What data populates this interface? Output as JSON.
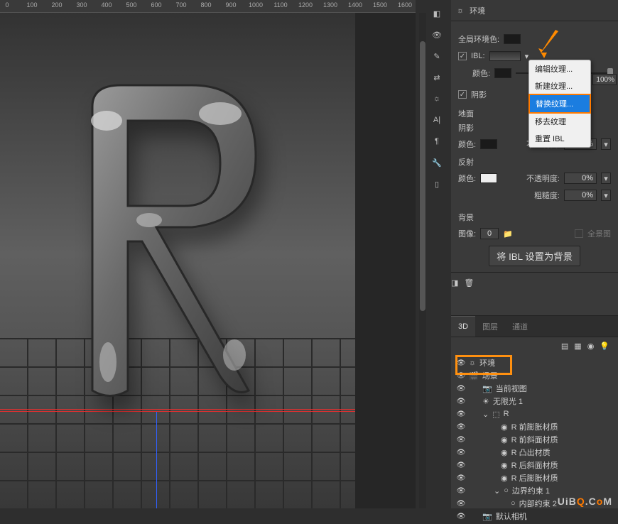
{
  "ruler": [
    "0",
    "100",
    "200",
    "300",
    "400",
    "500",
    "600",
    "700",
    "800",
    "900",
    "1000",
    "1100",
    "1200",
    "1300",
    "1400",
    "1500",
    "1600"
  ],
  "panel": {
    "title": "环境",
    "global_color_label": "全局环境色:",
    "ibl_label": "IBL:",
    "ibl_pct": "100%",
    "color_label": "颜色:",
    "shadow_label": "阴影",
    "ground_label": "地面",
    "ground_shadow_label": "阴影",
    "ground_color_label": "颜色:",
    "opacity_label": "不透明度:",
    "opacity_val": "60%",
    "reflection_label": "反射",
    "refl_color_label": "颜色:",
    "refl_opacity_label": "不透明度:",
    "refl_opacity_val": "0%",
    "roughness_label": "粗糙度:",
    "roughness_val": "0%",
    "background_label": "背景",
    "image_label": "图像:",
    "image_val": "0",
    "panorama_label": "全景图",
    "set_ibl_btn": "将 IBL 设置为背景"
  },
  "context_menu": {
    "edit": "编辑纹理...",
    "new": "新建纹理...",
    "replace": "替换纹理...",
    "remove": "移去纹理",
    "reset": "重置 IBL"
  },
  "tabs": {
    "d3": "3D",
    "layers": "图层",
    "channels": "通道"
  },
  "tree": {
    "env": "环境",
    "scene": "场景",
    "currentView": "当前视图",
    "light": "无限光 1",
    "r": "R",
    "mat_front_expand": "R 前膨胀材质",
    "mat_front_bevel": "R 前斜面材质",
    "mat_extrude": "R 凸出材质",
    "mat_back_bevel": "R 后斜面材质",
    "mat_back_expand": "R 后膨胀材质",
    "constraint1": "边界约束 1",
    "inner": "内部约束 2",
    "camera": "默认相机"
  },
  "watermark": {
    "t1": "UiB",
    "t2": "Q",
    "t3": ".C",
    "t4": "o",
    "t5": "M"
  }
}
